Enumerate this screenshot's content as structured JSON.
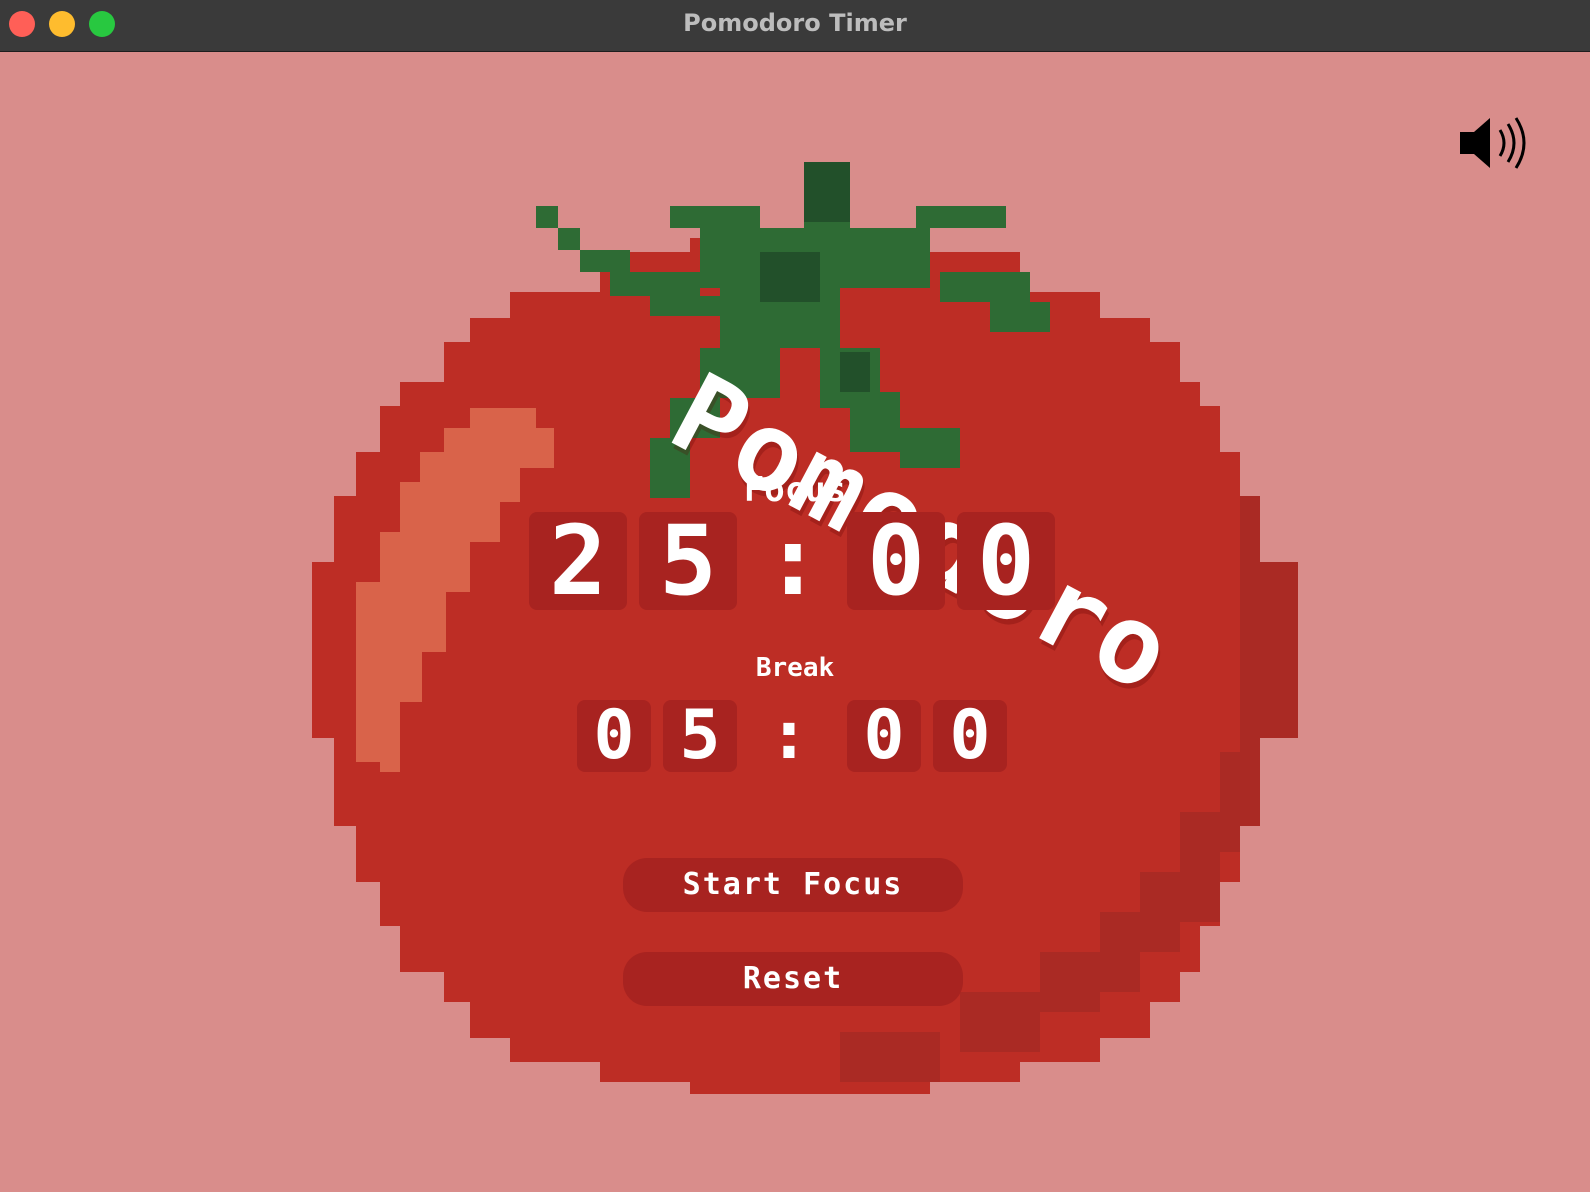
{
  "window": {
    "title": "Pomodoro Timer",
    "controls": [
      "close",
      "minimize",
      "maximize"
    ]
  },
  "header": {
    "sound_icon": "speaker-icon"
  },
  "artwork": {
    "logo_text": "Pomodoro",
    "illustration": "pixel-tomato"
  },
  "timer": {
    "focus": {
      "label": "Focus",
      "digits": [
        "2",
        "5",
        "0",
        "0"
      ],
      "separator": ":"
    },
    "break": {
      "label": "Break",
      "digits": [
        "0",
        "5",
        "0",
        "0"
      ],
      "separator": ":"
    }
  },
  "buttons": {
    "start_label": "Start Focus",
    "reset_label": "Reset"
  },
  "colors": {
    "background": "#d98d8b",
    "tomato_red": "#bd2d25",
    "tomato_dark": "#a82320",
    "leaf_green": "#2e6b34",
    "highlight": "#d9634a",
    "text": "#ffffff"
  }
}
